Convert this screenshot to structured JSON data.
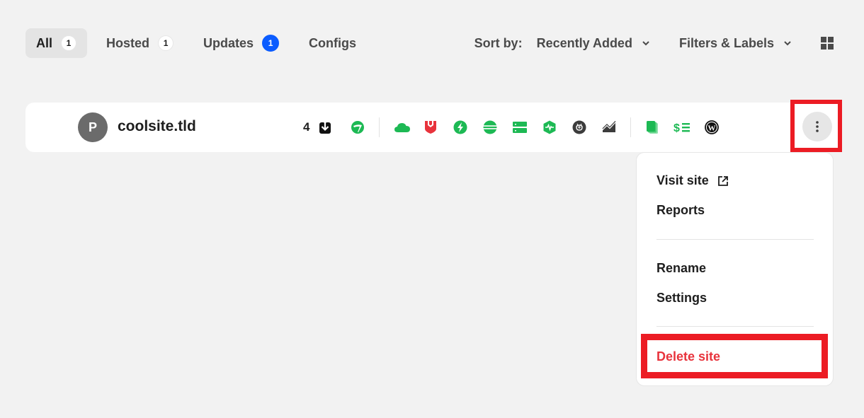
{
  "tabs": [
    {
      "label": "All",
      "count": "1",
      "active": true
    },
    {
      "label": "Hosted",
      "count": "1"
    },
    {
      "label": "Updates",
      "count": "1",
      "highlight": true
    },
    {
      "label": "Configs"
    }
  ],
  "controls": {
    "sort_label": "Sort by:",
    "sort_value": "Recently Added",
    "filters_label": "Filters & Labels",
    "view_icon": "grid-view-icon"
  },
  "site": {
    "avatar_letter": "P",
    "name": "coolsite.tld",
    "update_count": "4",
    "status_icons": [
      "updates-download-icon",
      "backups-icon",
      "cloud-icon",
      "security-shield-icon",
      "performance-bolt-icon",
      "database-icon",
      "server-icon",
      "uptime-monitor-icon",
      "brain-icon",
      "analytics-chart-icon",
      "documents-icon",
      "billing-icon",
      "wordpress-icon"
    ]
  },
  "menu": {
    "visit_site": "Visit site",
    "reports": "Reports",
    "rename": "Rename",
    "settings": "Settings",
    "delete_site": "Delete site"
  },
  "colors": {
    "accent_green": "#1db954",
    "badge_blue": "#0b5cff",
    "danger_red": "#e8333c",
    "highlight_red": "#ec1c24"
  }
}
